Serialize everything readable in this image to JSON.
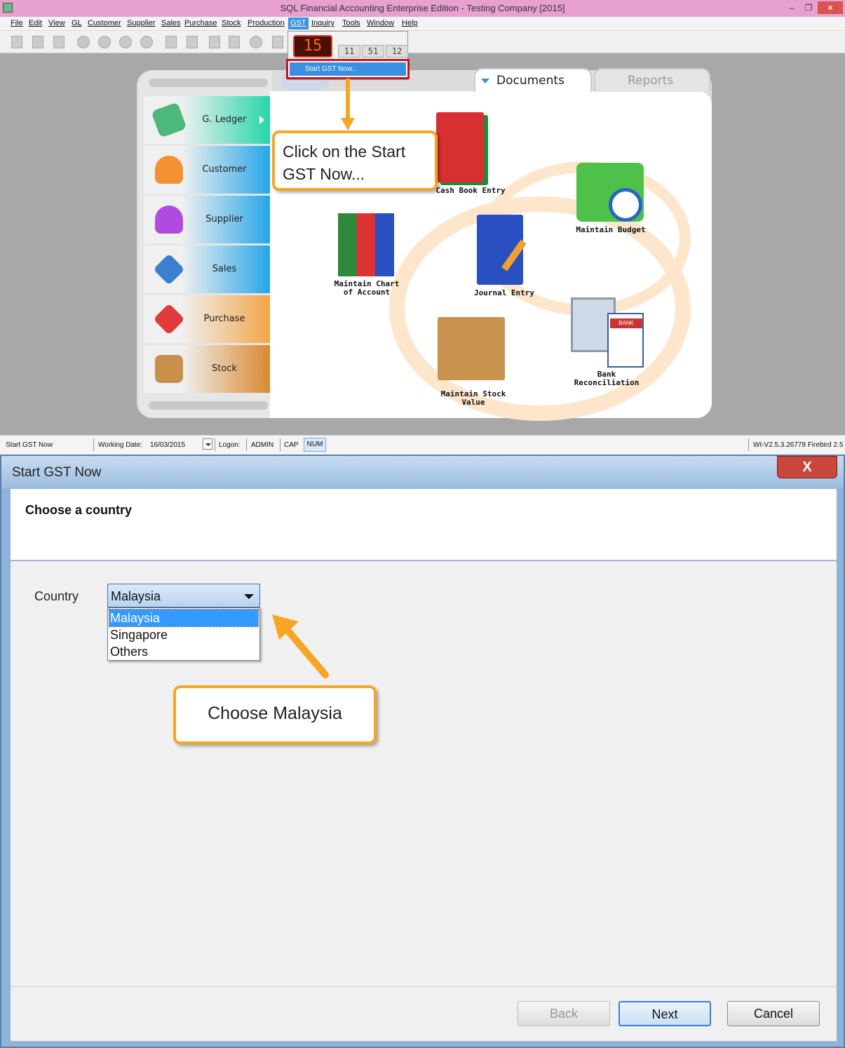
{
  "window": {
    "title": "SQL Financial Accounting Enterprise Edition - Testing Company [2015]",
    "minimize": "–",
    "restore": "❐",
    "close": "×"
  },
  "menu": [
    "File",
    "Edit",
    "View",
    "GL",
    "Customer",
    "Supplier",
    "Sales",
    "Purchase",
    "Stock",
    "Production",
    "GST",
    "Inquiry",
    "Tools",
    "Window",
    "Help"
  ],
  "gst_menu": {
    "icon_main": "15",
    "icon_small": [
      "11",
      "51",
      "12"
    ],
    "start_item": "Start GST Now..."
  },
  "nav": [
    "G. Ledger",
    "Customer",
    "Supplier",
    "Sales",
    "Purchase",
    "Stock"
  ],
  "tabs": {
    "documents": "Documents",
    "reports": "Reports"
  },
  "apps": {
    "cash_book": "Cash Book Entry",
    "budget": "Maintain Budget",
    "chart": "Maintain Chart of Account",
    "journal": "Journal Entry",
    "stock": "Maintain Stock Value",
    "bank": "Bank Reconciliation",
    "bank_badge": "BANK"
  },
  "callout_top": "Click on the Start GST Now...",
  "status": {
    "action": "Start GST Now",
    "working_date_label": "Working Date:",
    "working_date": "16/03/2015",
    "logon_label": "Logon:",
    "logon": "ADMIN",
    "cap": "CAP",
    "num": "NUM",
    "version": "WI-V2.5.3.26778 Firebird 2.5"
  },
  "dialog": {
    "title": "Start GST Now",
    "close": "X",
    "heading": "Choose a country",
    "country_label": "Country",
    "country_value": "Malaysia",
    "options": [
      "Malaysia",
      "Singapore",
      "Others"
    ],
    "callout": "Choose Malaysia",
    "buttons": {
      "back": "Back",
      "next": "Next",
      "cancel": "Cancel"
    }
  },
  "colors": {
    "accent": "#3b8fe0",
    "callout": "#f6a623",
    "highlight": "#d01020"
  }
}
